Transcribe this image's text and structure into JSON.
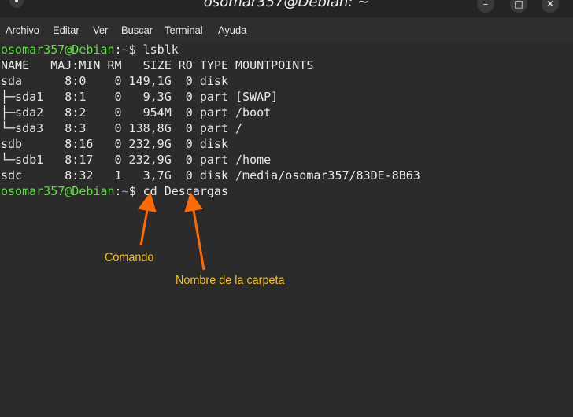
{
  "window": {
    "title": "osomar357@Debian: ~"
  },
  "menubar": {
    "items": [
      "Archivo",
      "Editar",
      "Ver",
      "Buscar",
      "Terminal",
      "Ayuda"
    ]
  },
  "terminal": {
    "prompt_user": "osomar357@Debian",
    "prompt_sep": ":",
    "prompt_path": "~",
    "prompt_end": "$ ",
    "command1": "lsblk",
    "output": [
      "NAME   MAJ:MIN RM   SIZE RO TYPE MOUNTPOINTS",
      "sda      8:0    0 149,1G  0 disk",
      "├─sda1   8:1    0   9,3G  0 part [SWAP]",
      "├─sda2   8:2    0   954M  0 part /boot",
      "└─sda3   8:3    0 138,8G  0 part /",
      "sdb      8:16   0 232,9G  0 disk",
      "└─sdb1   8:17   0 232,9G  0 part /home",
      "sdc      8:32   1   3,7G  0 disk /media/osomar357/83DE-8B63"
    ],
    "command2": "cd Descargas"
  },
  "annotations": {
    "comando": "Comando",
    "carpeta": "Nombre de la carpeta",
    "color": "#f6c400",
    "arrow_color": "#ff6a00"
  },
  "colors": {
    "background": "#2b2b2b",
    "prompt_user": "#5fdf43",
    "prompt_path": "#7aa6da",
    "text": "#e8e8e8"
  }
}
